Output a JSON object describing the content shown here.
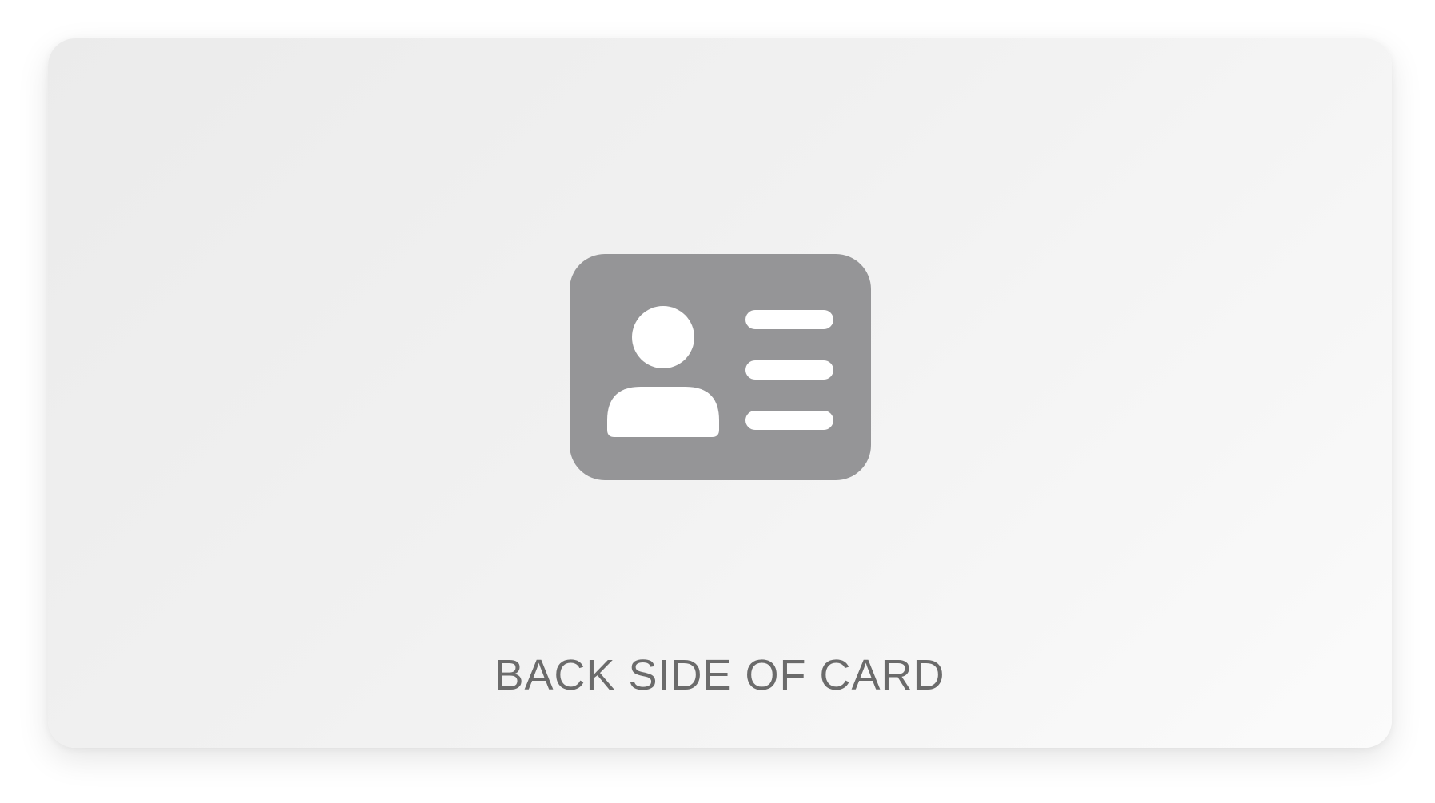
{
  "card": {
    "label": "BACK SIDE OF CARD",
    "icon": "id-card-icon",
    "icon_color": "#959597",
    "background_colors": [
      "#ebebeb",
      "#fbfbfb"
    ],
    "label_color": "#6b6b6b"
  }
}
